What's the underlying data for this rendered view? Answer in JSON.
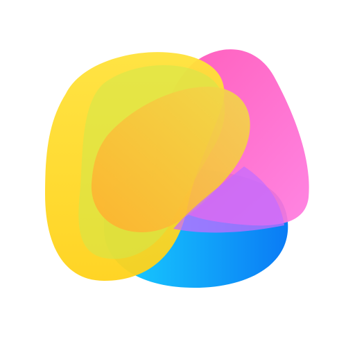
{
  "icon": {
    "name": "abstract-blob-icon",
    "background_color": "#ffffff",
    "colors": {
      "blue_start": "#19D3FF",
      "blue_end": "#0A7BF5",
      "pink_start": "#FF4FB5",
      "pink_end": "#FF7BE0",
      "violet": "#C56CFF",
      "yellow_start": "#FFE23A",
      "yellow_end": "#FFD21A",
      "lime": "#CFE94B",
      "orange": "#FFB02E"
    }
  }
}
